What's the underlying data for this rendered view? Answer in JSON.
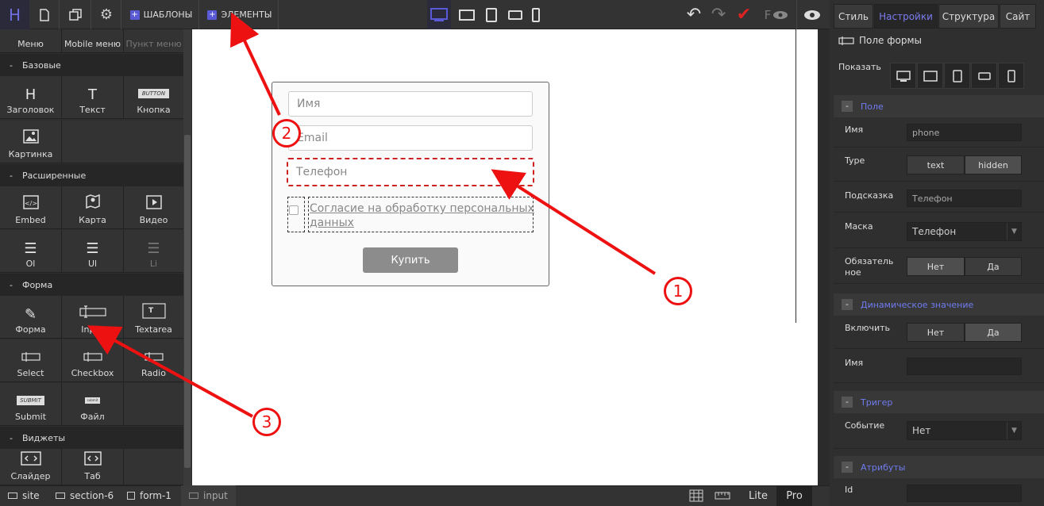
{
  "topbar": {
    "logo": "H",
    "templates_label": "ШАБЛОНЫ",
    "elements_label": "ЭЛЕМЕНТЫ",
    "preview_letter": "F"
  },
  "left": {
    "top_row": [
      "Меню",
      "Mobile меню",
      "Пункт меню"
    ],
    "sections": {
      "basic": "Базовые",
      "extended": "Расширенные",
      "form": "Форма",
      "widgets": "Виджеты"
    },
    "basic_items": [
      {
        "label": "Заголовок",
        "icon": "H"
      },
      {
        "label": "Текст",
        "icon": "T"
      },
      {
        "label": "Кнопка",
        "icon": "BUTTON"
      },
      {
        "label": "Картинка",
        "icon": "image-icon"
      }
    ],
    "extended_items": [
      {
        "label": "Embed",
        "icon": "embed-icon"
      },
      {
        "label": "Карта",
        "icon": "map-icon"
      },
      {
        "label": "Видео",
        "icon": "video-icon"
      },
      {
        "label": "Ol",
        "icon": "list-icon"
      },
      {
        "label": "Ul",
        "icon": "list-icon"
      },
      {
        "label": "Li",
        "icon": "list-icon"
      }
    ],
    "form_items": [
      {
        "label": "Форма",
        "icon": "edit-icon"
      },
      {
        "label": "Input",
        "icon": "input-icon"
      },
      {
        "label": "Textarea",
        "icon": "T"
      },
      {
        "label": "Select",
        "icon": "input-icon"
      },
      {
        "label": "Checkbox",
        "icon": "input-icon"
      },
      {
        "label": "Radio",
        "icon": "input-icon"
      },
      {
        "label": "Submit",
        "icon": "SUBMIT"
      },
      {
        "label": "Файл",
        "icon": "file-icon"
      }
    ],
    "widget_items": [
      {
        "label": "Слайдер",
        "icon": "slider-icon"
      },
      {
        "label": "Таб",
        "icon": "tab-icon"
      }
    ]
  },
  "canvas": {
    "name_placeholder": "Имя",
    "email_placeholder": "Email",
    "phone_placeholder": "Телефон",
    "consent_text": "Согласие на обработку персональных данных",
    "buy_label": "Купить"
  },
  "right": {
    "tabs": [
      "Стиль",
      "Настройки",
      "Структура",
      "Сайт"
    ],
    "title": "Поле формы",
    "show_label": "Показать",
    "field_section": "Поле",
    "name_label": "Имя",
    "name_value": "phone",
    "type_label": "Type",
    "type_text": "text",
    "type_hidden": "hidden",
    "hint_label": "Подсказка",
    "hint_value": "Телефон",
    "mask_label": "Маска",
    "mask_value": "Телефон",
    "required_label": "Обязательное",
    "no": "Нет",
    "yes": "Да",
    "dynamic_section": "Динамическое значение",
    "enable_label": "Включить",
    "dyn_name_label": "Имя",
    "trigger_section": "Тригер",
    "event_label": "Событие",
    "event_value": "Нет",
    "attributes_section": "Атрибуты",
    "id_label": "Id"
  },
  "bottom": {
    "breadcrumbs": [
      "site",
      "section-6",
      "form-1",
      "input"
    ],
    "lite": "Lite",
    "pro": "Pro"
  },
  "annotations": [
    "1",
    "2",
    "3"
  ],
  "colors": {
    "accent": "#6f7bf0",
    "arrow": "#e11111"
  }
}
